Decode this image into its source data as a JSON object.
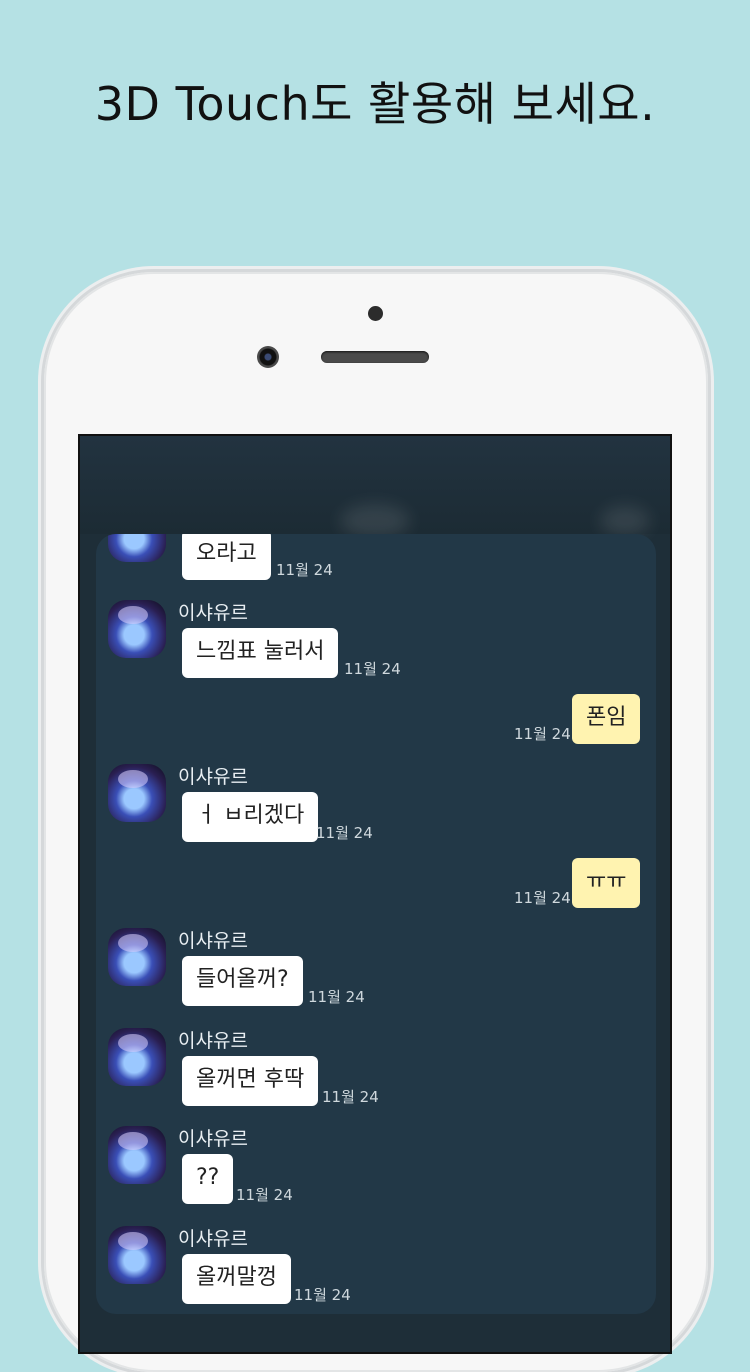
{
  "headline": "3D Touch도 활용해 보세요.",
  "messages": [
    {
      "side": "in",
      "name": "",
      "text": "오라고",
      "time": "11월 24"
    },
    {
      "side": "in",
      "name": "이샤유르",
      "text": "느낌표 눌러서",
      "time": "11월 24"
    },
    {
      "side": "out",
      "name": "",
      "text": "폰임",
      "time": "11월 24"
    },
    {
      "side": "in",
      "name": "이샤유르",
      "text": "ㅓ ㅂ리겠다",
      "time": "11월 24"
    },
    {
      "side": "out",
      "name": "",
      "text": "ㅠㅠ",
      "time": "11월 24"
    },
    {
      "side": "in",
      "name": "이샤유르",
      "text": "들어올꺼?",
      "time": "11월 24"
    },
    {
      "side": "in",
      "name": "이샤유르",
      "text": "올꺼면 후딱",
      "time": "11월 24"
    },
    {
      "side": "in",
      "name": "이샤유르",
      "text": "??",
      "time": "11월 24"
    },
    {
      "side": "in",
      "name": "이샤유르",
      "text": "올꺼말껑",
      "time": "11월 24"
    }
  ],
  "colors": {
    "background": "#b5e1e4",
    "incoming_bubble": "#ffffff",
    "outgoing_bubble": "#fff3b0",
    "chat_background": "#223847"
  }
}
